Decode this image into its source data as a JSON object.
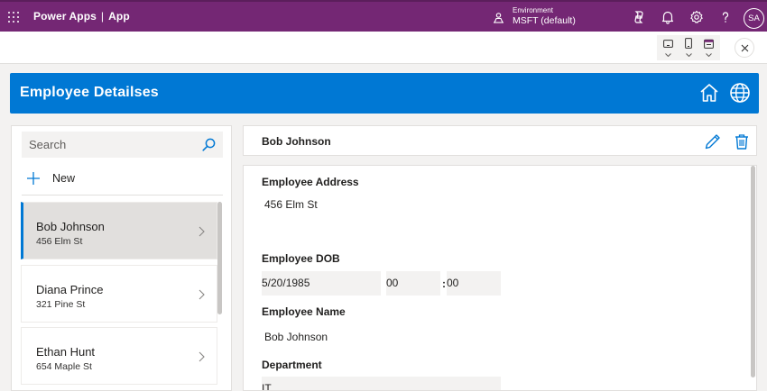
{
  "topbar": {
    "brand": "Power Apps",
    "separator": "|",
    "app": "App",
    "environment_label": "Environment",
    "environment_name": "MSFT (default)",
    "avatar_initials": "SA"
  },
  "header": {
    "title": "Employee Detailses"
  },
  "left_panel": {
    "search_placeholder": "Search",
    "new_label": "New",
    "items": [
      {
        "name": "Bob Johnson",
        "address": "456 Elm St"
      },
      {
        "name": "Diana Prince",
        "address": "321 Pine St"
      },
      {
        "name": "Ethan Hunt",
        "address": "654 Maple St"
      }
    ]
  },
  "detail": {
    "title": "Bob Johnson",
    "address_label": "Employee Address",
    "address_value": "456 Elm St",
    "dob_label": "Employee DOB",
    "dob_date": "5/20/1985",
    "dob_hour": "00",
    "dob_colon": ":",
    "dob_minute": "00",
    "name_label": "Employee Name",
    "name_value": "Bob Johnson",
    "department_label": "Department",
    "department_value": "IT"
  },
  "colors": {
    "topbar": "#742774",
    "header": "#0078d4",
    "selected_accent": "#0078d4"
  },
  "icons": [
    "waffle-icon",
    "environment-icon",
    "copilot-icon",
    "bell-icon",
    "gear-icon",
    "help-icon",
    "tablet-icon",
    "phone-icon",
    "calendar-icon",
    "close-icon",
    "home-icon",
    "globe-icon",
    "search-icon",
    "plus-icon",
    "chevron-right-icon",
    "edit-icon",
    "trash-icon"
  ]
}
